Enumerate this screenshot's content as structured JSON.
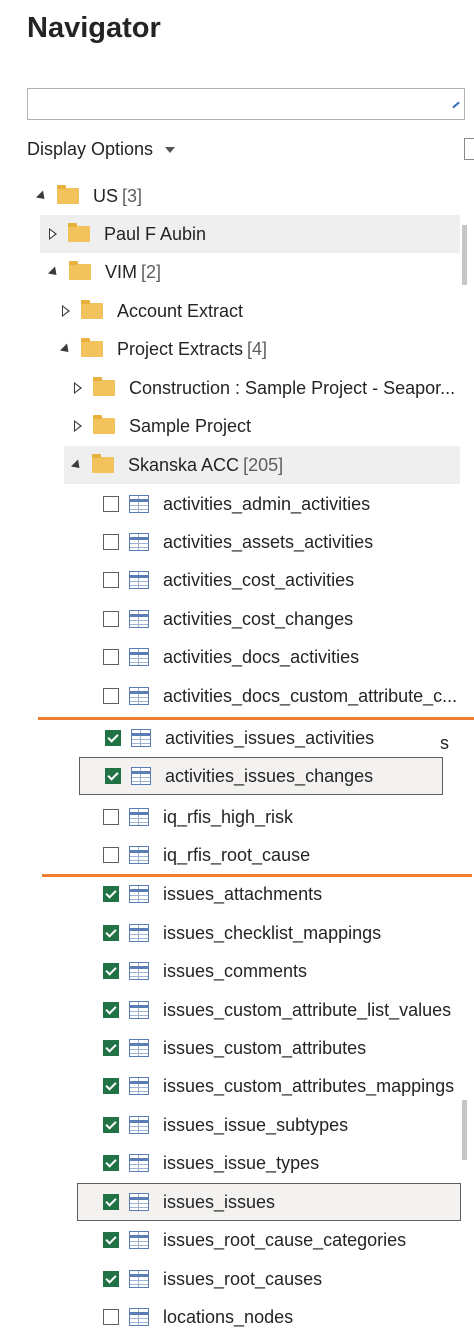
{
  "header": {
    "title": "Navigator"
  },
  "search": {
    "value": ""
  },
  "display_options": {
    "label": "Display Options"
  },
  "tree": {
    "us": {
      "label": "US",
      "count": "[3]"
    },
    "paul": {
      "label": "Paul F Aubin"
    },
    "vim": {
      "label": "VIM",
      "count": "[2]"
    },
    "account_extract": {
      "label": "Account Extract"
    },
    "project_extracts": {
      "label": "Project Extracts",
      "count": "[4]"
    },
    "construction": {
      "label": "Construction : Sample Project - Seapor..."
    },
    "sample_project": {
      "label": "Sample Project"
    },
    "skanska": {
      "label": "Skanska ACC",
      "count": "[205]"
    }
  },
  "tables_top": [
    {
      "label": "activities_admin_activities",
      "checked": false
    },
    {
      "label": "activities_assets_activities",
      "checked": false
    },
    {
      "label": "activities_cost_activities",
      "checked": false
    },
    {
      "label": "activities_cost_changes",
      "checked": false
    },
    {
      "label": "activities_docs_activities",
      "checked": false
    },
    {
      "label": "activities_docs_custom_attribute_c...",
      "checked": false
    }
  ],
  "tables_mid": [
    {
      "label": "activities_issues_activities",
      "checked": true
    },
    {
      "label": "activities_issues_changes",
      "checked": true
    },
    {
      "label": "iq_rfis_high_risk",
      "checked": false
    },
    {
      "label": "iq_rfis_root_cause",
      "checked": false
    }
  ],
  "stray_text": "s",
  "tables_bottom": [
    {
      "label": "issues_attachments",
      "checked": true
    },
    {
      "label": "issues_checklist_mappings",
      "checked": true
    },
    {
      "label": "issues_comments",
      "checked": true
    },
    {
      "label": "issues_custom_attribute_list_values",
      "checked": true
    },
    {
      "label": "issues_custom_attributes",
      "checked": true
    },
    {
      "label": "issues_custom_attributes_mappings",
      "checked": true
    },
    {
      "label": "issues_issue_subtypes",
      "checked": true
    },
    {
      "label": "issues_issue_types",
      "checked": true
    },
    {
      "label": "issues_issues",
      "checked": true
    },
    {
      "label": "issues_root_cause_categories",
      "checked": true
    },
    {
      "label": "issues_root_causes",
      "checked": true
    },
    {
      "label": "locations_nodes",
      "checked": false
    }
  ],
  "colors": {
    "accent_check": "#217346",
    "annotation_line": "#ed7d31",
    "folder": "#f2c25c"
  }
}
